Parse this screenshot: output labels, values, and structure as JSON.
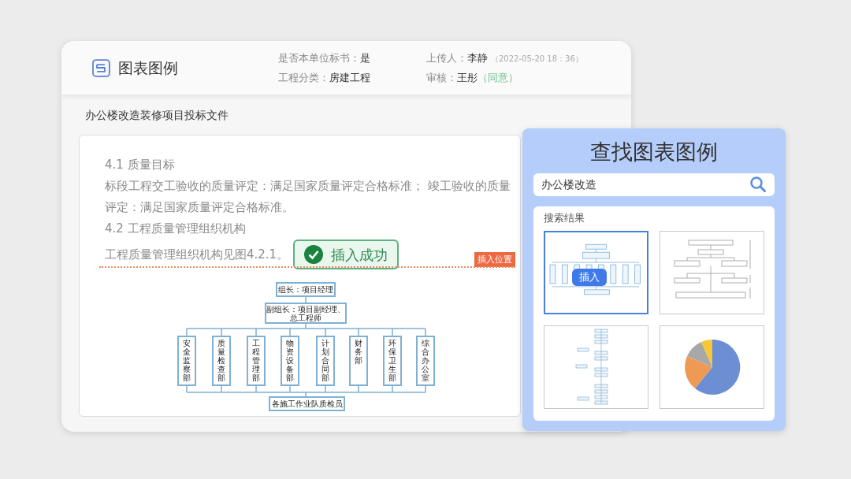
{
  "header": {
    "title": "图表图例",
    "meta": [
      {
        "label": "是否本单位标书：",
        "value": "是"
      },
      {
        "label": "上传人：",
        "value": "李静",
        "note": "（2022-05-20  18：36）",
        "kind": "time"
      },
      {
        "label": "工程分类：",
        "value": "房建工程"
      },
      {
        "label": "审核：",
        "value": "王彤",
        "note": "（同意）",
        "kind": "approval"
      }
    ]
  },
  "document": {
    "title": "办公楼改造装修项目投标文件",
    "paragraphs": [
      "4.1 质量目标",
      "标段工程交工验收的质量评定：满足国家质量评定合格标准； 竣工验收的质量评定：满足国家质量评定合格标准。",
      "4.2 工程质量管理组织机构",
      "工程质量管理组织机构见图4.2.1。"
    ],
    "toast": "插入成功",
    "insert_marker": "插入位置",
    "org_chart": {
      "top": "组长：项目经理",
      "deputy": [
        "副组长：项目副经理、",
        "总工程师"
      ],
      "departments": [
        "安全监察部",
        "质量检查部",
        "工程管理部",
        "物资设备部",
        "计划合同部",
        "财务部",
        "环保卫生部",
        "综合办公室"
      ],
      "bottom": "各施工作业队质检员"
    }
  },
  "search_panel": {
    "title": "查找图表图例",
    "query": "办公楼改造",
    "results_label": "搜索结果",
    "results": [
      {
        "kind": "org_chart",
        "selected": true,
        "action": "插入"
      },
      {
        "kind": "flowchart",
        "selected": false
      },
      {
        "kind": "process",
        "selected": false
      },
      {
        "kind": "pie",
        "selected": false
      }
    ]
  }
}
